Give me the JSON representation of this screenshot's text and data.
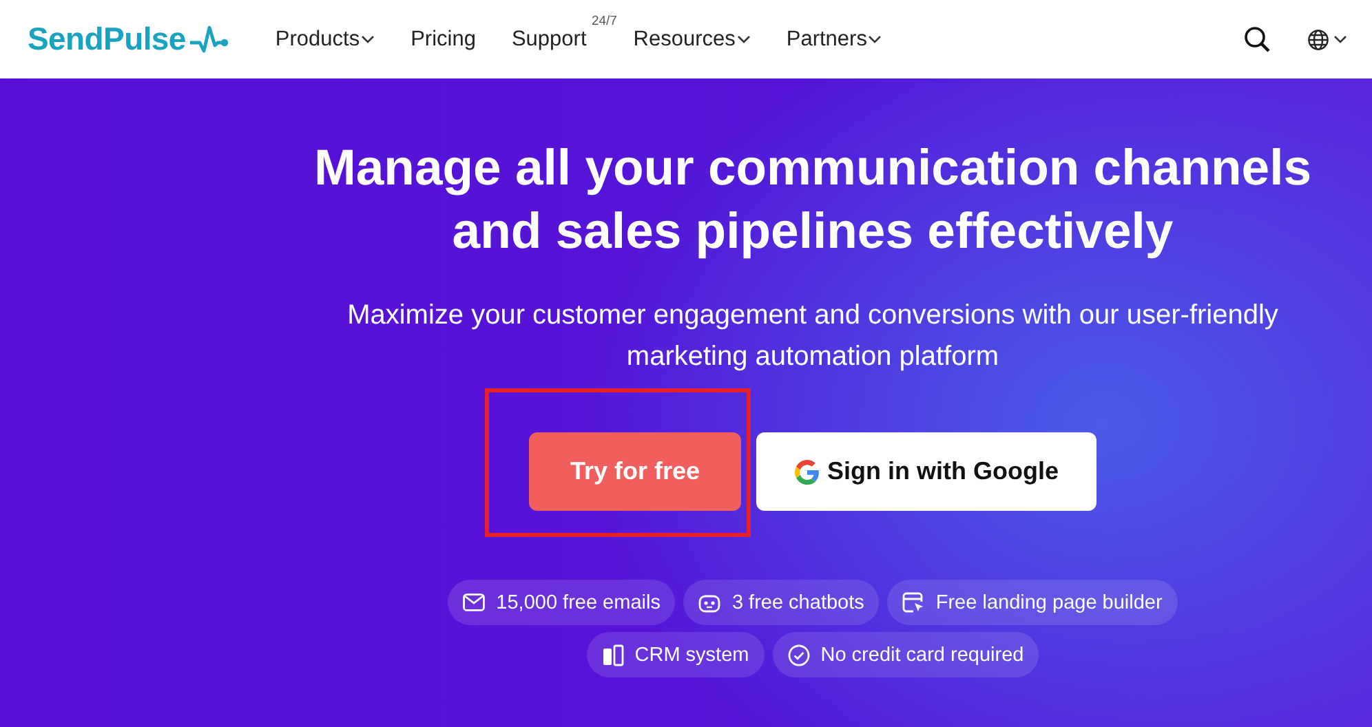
{
  "header": {
    "logo": "SendPulse",
    "nav": [
      {
        "label": "Products",
        "has_menu": true
      },
      {
        "label": "Pricing",
        "has_menu": false
      },
      {
        "label": "Support",
        "has_menu": false,
        "badge": "24/7"
      },
      {
        "label": "Resources",
        "has_menu": true
      },
      {
        "label": "Partners",
        "has_menu": true
      }
    ]
  },
  "hero": {
    "title_lines": [
      "Manage all your communication channels",
      "and sales pipelines effectively"
    ],
    "subtitle_lines": [
      "Maximize your customer engagement and conversions with our user-friendly",
      "marketing automation platform"
    ],
    "buttons": [
      {
        "kind": "primary",
        "label": "Try for free",
        "highlighted": true
      },
      {
        "kind": "google",
        "label": "Sign in with Google",
        "highlighted": false
      }
    ],
    "features": [
      [
        {
          "kind": "mail",
          "label": "15,000 free emails"
        },
        {
          "kind": "bot",
          "label": "3 free chatbots"
        },
        {
          "kind": "page",
          "label": "Free landing page builder"
        }
      ],
      [
        {
          "kind": "crm",
          "label": "CRM system"
        },
        {
          "kind": "check",
          "label": "No credit card required"
        }
      ]
    ]
  }
}
